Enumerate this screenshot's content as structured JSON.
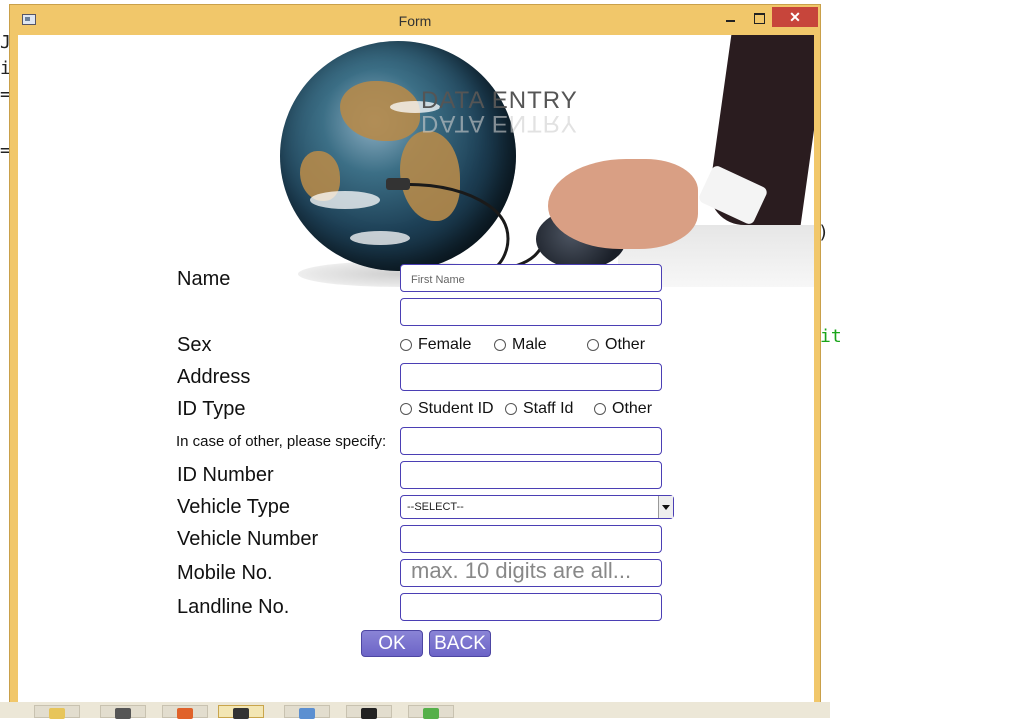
{
  "window": {
    "title": "Form"
  },
  "banner": {
    "title": "DATA ENTRY"
  },
  "form": {
    "name_label": "Name",
    "first_name_placeholder": "First Name",
    "sex_label": "Sex",
    "sex_options": [
      "Female",
      "Male",
      "Other"
    ],
    "address_label": "Address",
    "id_type_label": "ID Type",
    "id_type_options": [
      "Student ID",
      "Staff Id",
      "Other"
    ],
    "other_specify_label": "In case of other, please specify:",
    "id_number_label": "ID Number",
    "vehicle_type_label": "Vehicle Type",
    "vehicle_type_selected": "--SELECT--",
    "vehicle_number_label": "Vehicle Number",
    "mobile_label": "Mobile No.",
    "mobile_placeholder": "max. 10 digits are all...",
    "landline_label": "Landline No."
  },
  "buttons": {
    "ok": "OK",
    "back": "BACK"
  },
  "background": {
    "left_chars": [
      "J",
      "i",
      "=",
      "="
    ],
    "right_char": ")",
    "right_green": "it"
  }
}
